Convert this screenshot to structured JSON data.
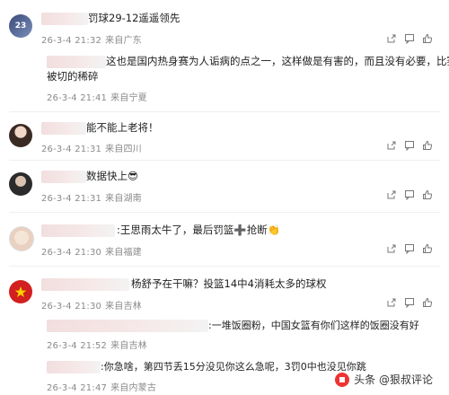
{
  "comments": [
    {
      "text": "罚球29-12遥遥领先",
      "time": "26-3-4 21:32",
      "location": "来自广东"
    },
    {
      "text": "这也是国内热身赛为人诟病的点之一，这样做是有害的，而且没有必要，比赛也",
      "text2": "被切的稀碎",
      "time": "26-3-4 21:41",
      "location": "来自宁夏"
    },
    {
      "text": "能不能上老将！",
      "time": "26-3-4 21:31",
      "location": "来自四川"
    },
    {
      "text": "数据快上",
      "emoji": "😎",
      "time": "26-3-4 21:31",
      "location": "来自湖南"
    },
    {
      "text": ":王思雨太牛了，最后罚篮➕抢断",
      "emoji": "👏",
      "time": "26-3-4 21:30",
      "location": "来自福建"
    },
    {
      "text": "杨舒予在干嘛？投篮14中4消耗太多的球权",
      "time": "26-3-4 21:30",
      "location": "来自吉林"
    },
    {
      "text": ":一堆饭圈粉，中国女篮有你们这样的饭圈没有好",
      "time": "26-3-4 21:52",
      "location": "来自吉林"
    },
    {
      "text": ":你急啥，第四节丢15分没见你这么急呢，3罚0中也没见你跳",
      "time": "26-3-4 21:47",
      "location": "来自内蒙古"
    }
  ],
  "watermark": {
    "text": "头条 @狠叔评论"
  },
  "colors": {
    "meta": "#8a8a8a",
    "text": "#222222",
    "accent": "#e33333"
  }
}
